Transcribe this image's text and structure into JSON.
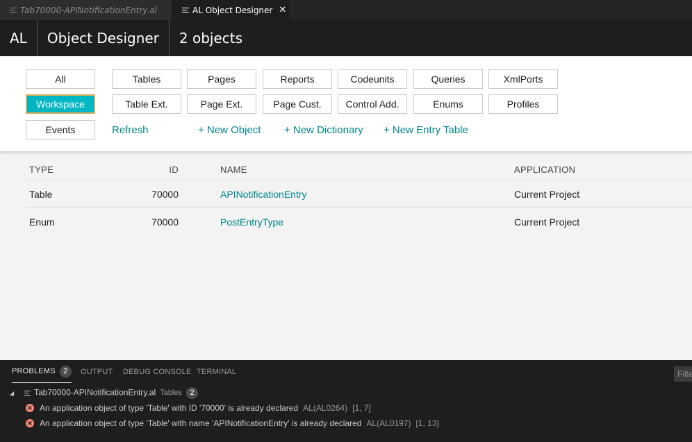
{
  "tabs": {
    "inactive_label": "Tab70000-APINotificationEntry.al",
    "active_label": "AL Object Designer"
  },
  "header": {
    "app": "AL",
    "title": "Object Designer",
    "count": "2 objects"
  },
  "filters": {
    "row1": [
      "All",
      "Tables",
      "Pages",
      "Reports",
      "Codeunits",
      "Queries",
      "XmlPorts"
    ],
    "row2": [
      "Workspace",
      "Table Ext.",
      "Page Ext.",
      "Page Cust.",
      "Control Add.",
      "Enums",
      "Profiles"
    ],
    "events": "Events",
    "selected": "Workspace",
    "links": {
      "refresh": "Refresh",
      "new_object": "+ New Object",
      "new_dictionary": "+ New Dictionary",
      "new_entry_table": "+ New Entry Table"
    }
  },
  "table": {
    "columns": {
      "type": "TYPE",
      "id": "ID",
      "name": "NAME",
      "application": "APPLICATION"
    },
    "rows": [
      {
        "type": "Table",
        "id": "70000",
        "name": "APINotificationEntry",
        "application": "Current Project"
      },
      {
        "type": "Enum",
        "id": "70000",
        "name": "PostEntryType",
        "application": "Current Project"
      }
    ]
  },
  "panel": {
    "tabs": {
      "problems": "PROBLEMS",
      "problems_count": "2",
      "output": "OUTPUT",
      "debug_console": "DEBUG CONSOLE",
      "terminal": "TERMINAL"
    },
    "filter_placeholder": "Filte",
    "file": {
      "name": "Tab70000-APINotificationEntry.al",
      "desc": "Tables",
      "count": "2"
    },
    "problems": [
      {
        "message": "An application object of type 'Table' with ID '70000' is already declared",
        "code": "AL(AL0264)",
        "position": "[1, 7]"
      },
      {
        "message": "An application object of type 'Table' with name 'APINotificationEntry' is already declared",
        "code": "AL(AL0197)",
        "position": "[1, 13]"
      }
    ]
  },
  "colors": {
    "accent": "#00b7c3",
    "link": "#008489",
    "error": "#f48771"
  }
}
